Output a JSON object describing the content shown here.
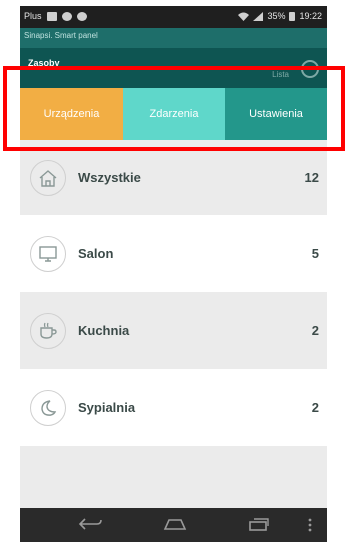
{
  "status_bar": {
    "carrier": "Plus",
    "time": "19:22",
    "battery": "35%"
  },
  "header": {
    "subtitle": "Sinapsi. Smart panel",
    "title": "Zasoby",
    "right_text": "Lista"
  },
  "tabs": [
    {
      "label": "Urządzenia"
    },
    {
      "label": "Zdarzenia"
    },
    {
      "label": "Ustawienia"
    }
  ],
  "rooms": [
    {
      "icon": "home-icon",
      "name": "Wszystkie",
      "count": "12"
    },
    {
      "icon": "tv-icon",
      "name": "Salon",
      "count": "5"
    },
    {
      "icon": "coffee-cup-icon",
      "name": "Kuchnia",
      "count": "2"
    },
    {
      "icon": "moon-icon",
      "name": "Sypialnia",
      "count": "2"
    }
  ],
  "colors": {
    "tab_active": "#f2ae44",
    "tab_2": "#5fd7ca",
    "tab_3": "#23978b",
    "header": "#0e5552",
    "highlight": "#ff0000"
  }
}
